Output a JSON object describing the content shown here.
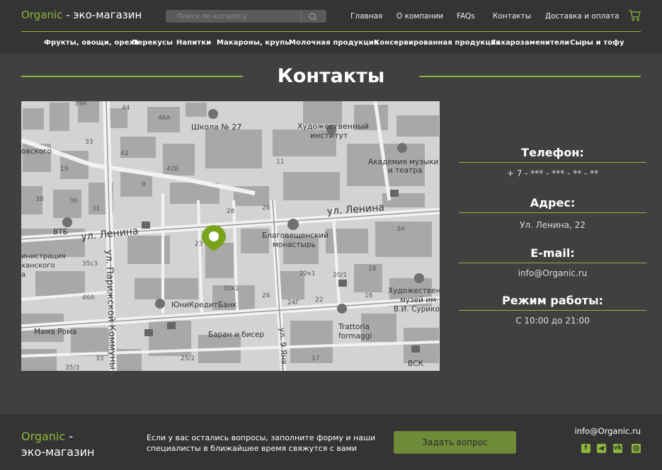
{
  "header": {
    "logo_brand": "Organic",
    "logo_rest": " - эко-магазин",
    "search_placeholder": "Поиск по каталогу",
    "nav": [
      "Главная",
      "О компании",
      "FAQs",
      "Контакты",
      "Доставка и оплата"
    ],
    "categories": [
      "Фрукты, овощи, орехи",
      "Перекусы",
      "Напитки",
      "Макароны, крупы",
      "Молочная продукция",
      "Консервированная продукция",
      "Сахарозаменители",
      "Сыры и тофу"
    ]
  },
  "page_title": "Контакты",
  "map": {
    "labels": {
      "school": "Школа № 27",
      "art_institute_1": "Художественный",
      "art_institute_2": "институт",
      "academy_1": "Академия музыки",
      "academy_2": "и театра",
      "lenina_1": "ул. Ленина",
      "lenina_2": "ул. Ленина",
      "monastery_1": "Благовещенский",
      "monastery_2": "монастырь",
      "parizhskoy": "ул. Парижской Коммуны",
      "yanvarya": "ул. 9 Янв...",
      "vtb": "ВТБ",
      "unicredit": "ЮниКредитБанк",
      "baran": "Баран и бисер",
      "mama_roma": "Мама Рома",
      "trattoria_1": "Trattoria",
      "trattoria_2": "formaggi",
      "museum_1": "Художественн",
      "museum_2": "музей им.",
      "museum_3": "В.И. Сурико",
      "vsk": "ВСК",
      "ovskogo": "овского",
      "admin_1": "инистрация",
      "admin_2": "ханского",
      "admin_3": "а",
      "n44": "44",
      "n46a": "46А",
      "n39a": "39А",
      "n33": "33",
      "n42": "42",
      "n19": "19",
      "n42b": "42Б",
      "n9": "9",
      "n38": "38",
      "n36": "36",
      "n31": "31",
      "n11": "11",
      "n28": "28",
      "n26": "26",
      "n23": "23",
      "n30k1": "30к1",
      "n26b": "26",
      "n24g": "24Г",
      "n22k1": "22к1",
      "n20_1": "20/1",
      "n18": "18",
      "n16": "16",
      "n22": "22",
      "n3a": "3А",
      "n35c3": "35с3",
      "n46a2": "46А",
      "n25_2": "25/2",
      "n17": "17",
      "n35_3": "35/3",
      "n33b": "33"
    }
  },
  "contacts": {
    "phone_head": "Телефон:",
    "phone": "+ 7 - *** - *** - ** - **",
    "address_head": "Адрес:",
    "address": "Ул. Ленина, 22",
    "email_head": "E-mail:",
    "email": "info@Organic.ru",
    "hours_head": "Режим работы:",
    "hours": "С 10:00 до 21:00"
  },
  "footer": {
    "logo_brand": "Organic",
    "logo_dash": " -",
    "logo_rest": "эко-магазин",
    "text": "Если у вас остались вопросы, заполните форму и наши специалисты в ближайшее время свяжутся с вами",
    "button": "Задать вопрос",
    "email": "info@Organic.ru",
    "socials": [
      "facebook",
      "telegram",
      "vk",
      "instagram"
    ]
  },
  "colors": {
    "accent": "#8fb63c",
    "header_bg": "#343434",
    "page_bg": "#404040",
    "button": "#6f8a39"
  }
}
